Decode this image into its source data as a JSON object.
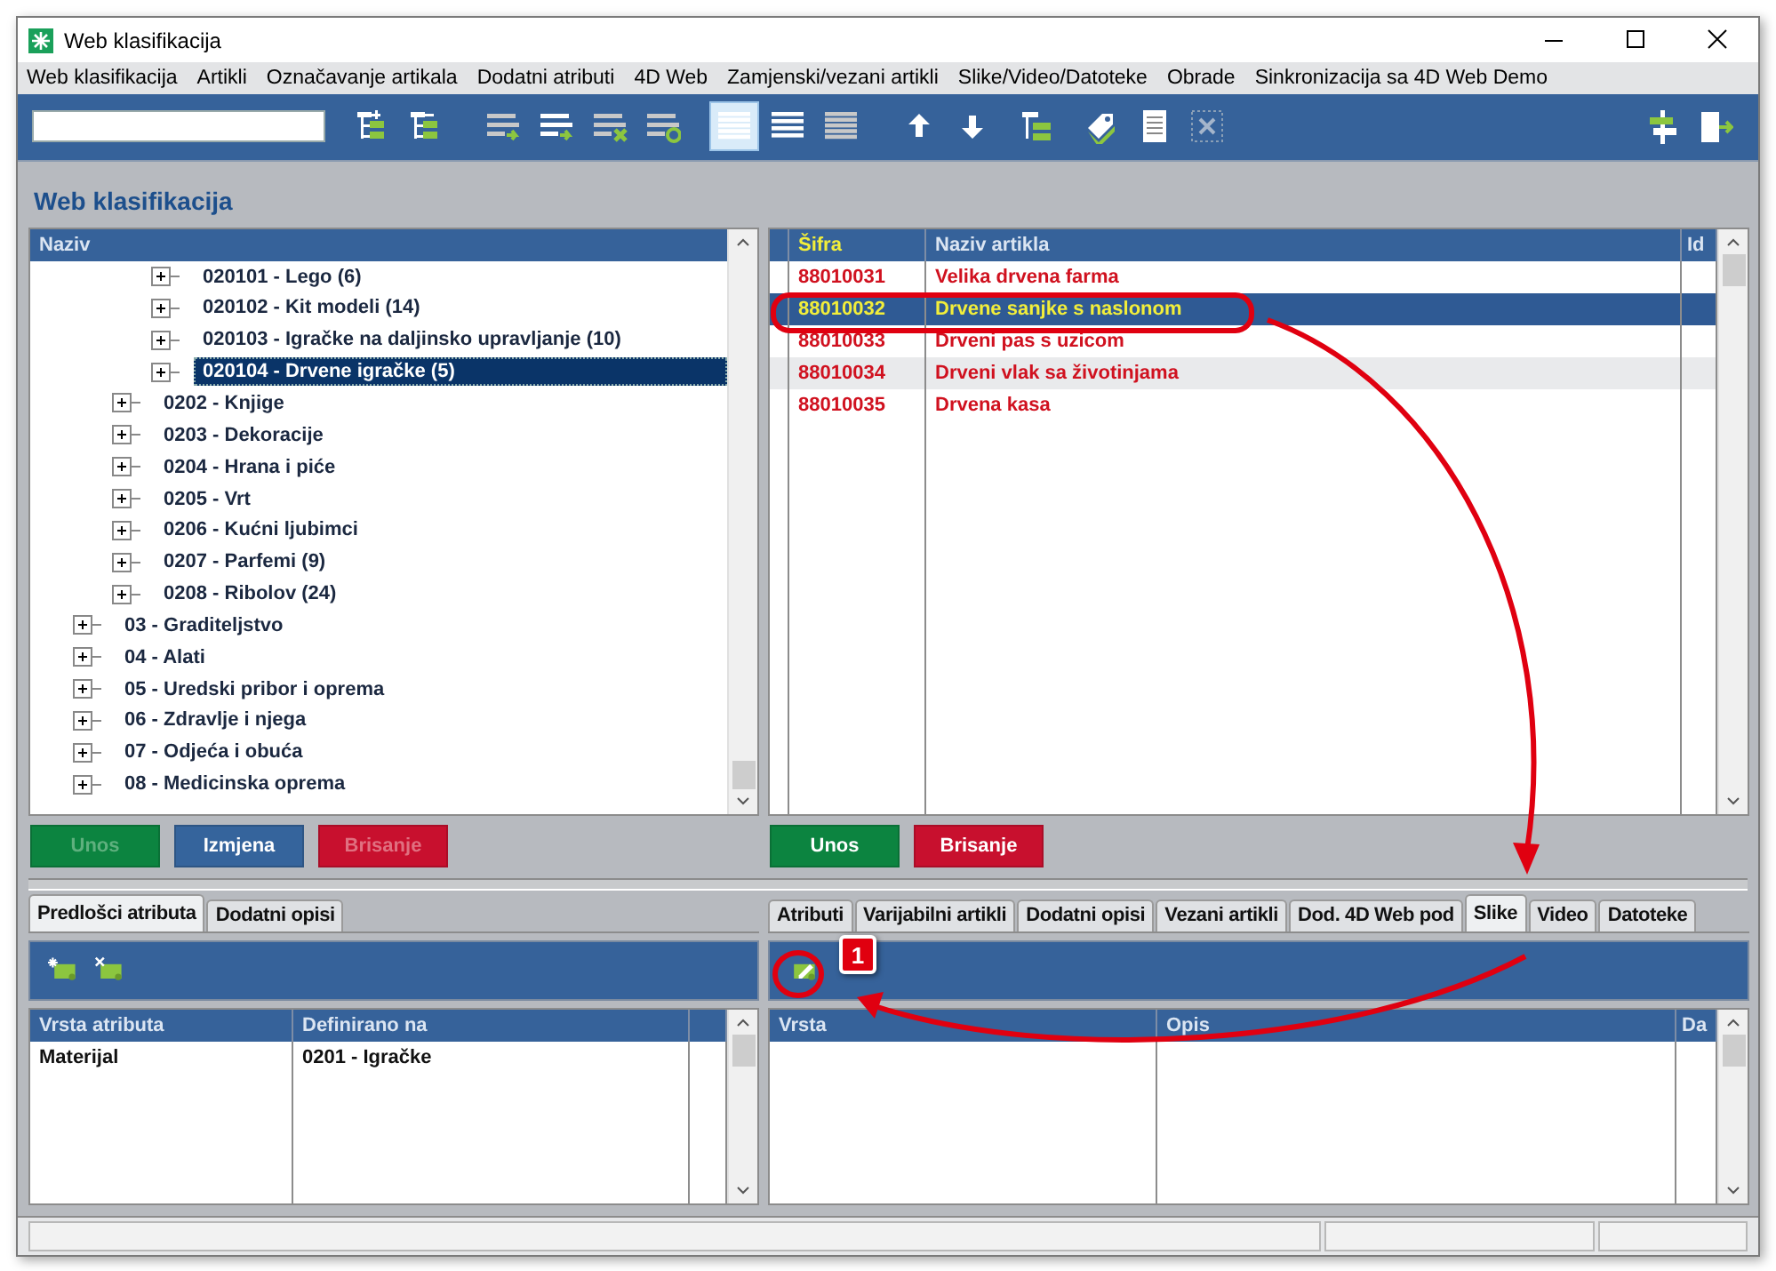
{
  "window": {
    "title": "Web klasifikacija"
  },
  "menu": [
    "Web klasifikacija",
    "Artikli",
    "Označavanje artikala",
    "Dodatni atributi",
    "4D Web",
    "Zamjenski/vezani artikli",
    "Slike/Video/Datoteke",
    "Obrade",
    "Sinkronizacija sa 4D Web Demo"
  ],
  "toolbar": {
    "buttons": [
      {
        "kind": "tree-add",
        "selected": false,
        "disabled": false
      },
      {
        "kind": "tree-remove",
        "selected": false,
        "disabled": false
      },
      {
        "kind": "list-add",
        "selected": false,
        "disabled": false
      },
      {
        "kind": "list-add-bold",
        "selected": false,
        "disabled": false
      },
      {
        "kind": "list-delete",
        "selected": false,
        "disabled": false
      },
      {
        "kind": "list-refresh",
        "selected": false,
        "disabled": false
      },
      {
        "kind": "rows-wide",
        "selected": true,
        "disabled": false
      },
      {
        "kind": "rows-medium",
        "selected": false,
        "disabled": false
      },
      {
        "kind": "rows-narrow",
        "selected": false,
        "disabled": false
      },
      {
        "kind": "arrow-up",
        "selected": false,
        "disabled": false
      },
      {
        "kind": "arrow-down",
        "selected": false,
        "disabled": false
      },
      {
        "kind": "tree-green",
        "selected": false,
        "disabled": false
      },
      {
        "kind": "tag",
        "selected": false,
        "disabled": false
      },
      {
        "kind": "document",
        "selected": false,
        "disabled": false
      },
      {
        "kind": "close-box",
        "selected": false,
        "disabled": true
      }
    ],
    "right_buttons": [
      {
        "kind": "signpost"
      },
      {
        "kind": "exit"
      }
    ]
  },
  "heading": "Web klasifikacija",
  "tree": {
    "header": "Naziv",
    "items": [
      {
        "children": [
          {
            "children": [
              {
                "label": "020101 - Lego (6)",
                "selected": false,
                "expanded": false
              },
              {
                "label": "020102 - Kit modeli (14)",
                "selected": false,
                "expanded": false
              },
              {
                "label": "020103 - Igračke na daljinsko upravljanje (10)",
                "selected": false,
                "expanded": false
              },
              {
                "label": "020104 - Drvene igračke (5)",
                "selected": true,
                "expanded": false
              }
            ]
          },
          {
            "label": "0202 - Knjige",
            "selected": false,
            "expanded": false
          },
          {
            "label": "0203 - Dekoracije",
            "selected": false,
            "expanded": false
          },
          {
            "label": "0204 - Hrana i piće",
            "selected": false,
            "expanded": false
          },
          {
            "label": "0205 - Vrt",
            "selected": false,
            "expanded": false
          },
          {
            "label": "0206 - Kućni ljubimci",
            "selected": false,
            "expanded": false
          },
          {
            "label": "0207 - Parfemi (9)",
            "selected": false,
            "expanded": false
          },
          {
            "label": "0208 - Ribolov (24)",
            "selected": false,
            "expanded": false
          }
        ]
      },
      {
        "label": "03 - Graditeljstvo",
        "selected": false,
        "expanded": false
      },
      {
        "label": "04 - Alati",
        "selected": false,
        "expanded": false
      },
      {
        "label": "05 - Uredski pribor i oprema",
        "selected": false,
        "expanded": false
      },
      {
        "label": "06 - Zdravlje i njega",
        "selected": false,
        "expanded": false
      },
      {
        "label": "07 - Odjeća i obuća",
        "selected": false,
        "expanded": false
      },
      {
        "label": "08 - Medicinska oprema",
        "selected": false,
        "expanded": false
      }
    ],
    "buttons": [
      {
        "label": "Unos",
        "kind": "add",
        "disabled": true
      },
      {
        "label": "Izmjena",
        "kind": "edit",
        "disabled": false
      },
      {
        "label": "Brisanje",
        "kind": "delete",
        "disabled": true
      }
    ]
  },
  "articles": {
    "columns": [
      {
        "label": "Šifra",
        "sorted": true
      },
      {
        "label": "Naziv artikla",
        "sorted": false
      },
      {
        "label": "Id",
        "sorted": false
      }
    ],
    "rows": [
      {
        "sifra": "88010031",
        "naziv": "Velika drvena farma",
        "selected": false
      },
      {
        "sifra": "88010032",
        "naziv": "Drvene sanjke s naslonom",
        "selected": true
      },
      {
        "sifra": "88010033",
        "naziv": "Drveni pas s uzicom",
        "selected": false
      },
      {
        "sifra": "88010034",
        "naziv": "Drveni vlak sa životinjama",
        "selected": false
      },
      {
        "sifra": "88010035",
        "naziv": "Drvena kasa",
        "selected": false
      }
    ],
    "buttons": [
      {
        "label": "Unos",
        "kind": "add",
        "disabled": false
      },
      {
        "label": "Brisanje",
        "kind": "delete",
        "disabled": false
      }
    ]
  },
  "attributes_panel": {
    "tabs": [
      {
        "label": "Predlošci atributa",
        "selected": true
      },
      {
        "label": "Dodatni opisi",
        "selected": false
      }
    ],
    "tools": [
      {
        "kind": "add-tag"
      },
      {
        "kind": "remove-tag"
      }
    ],
    "columns": [
      "Vrsta atributa",
      "Definirano na"
    ],
    "rows": [
      {
        "vrsta_atributa": "Materijal",
        "definirano_na": "0201 - Igračke"
      }
    ]
  },
  "media_panel": {
    "tabs": [
      {
        "label": "Atributi",
        "selected": false
      },
      {
        "label": "Varijabilni artikli",
        "selected": false
      },
      {
        "label": "Dodatni opisi",
        "selected": false
      },
      {
        "label": "Vezani artikli",
        "selected": false
      },
      {
        "label": "Dod. 4D Web pod",
        "selected": false
      },
      {
        "label": "Slike",
        "selected": true
      },
      {
        "label": "Video",
        "selected": false
      },
      {
        "label": "Datoteke",
        "selected": false
      }
    ],
    "tools": [
      {
        "kind": "edit-tag"
      }
    ],
    "columns": [
      "Vrsta",
      "Opis",
      "Da"
    ]
  },
  "annotations": {
    "badge": "1"
  }
}
